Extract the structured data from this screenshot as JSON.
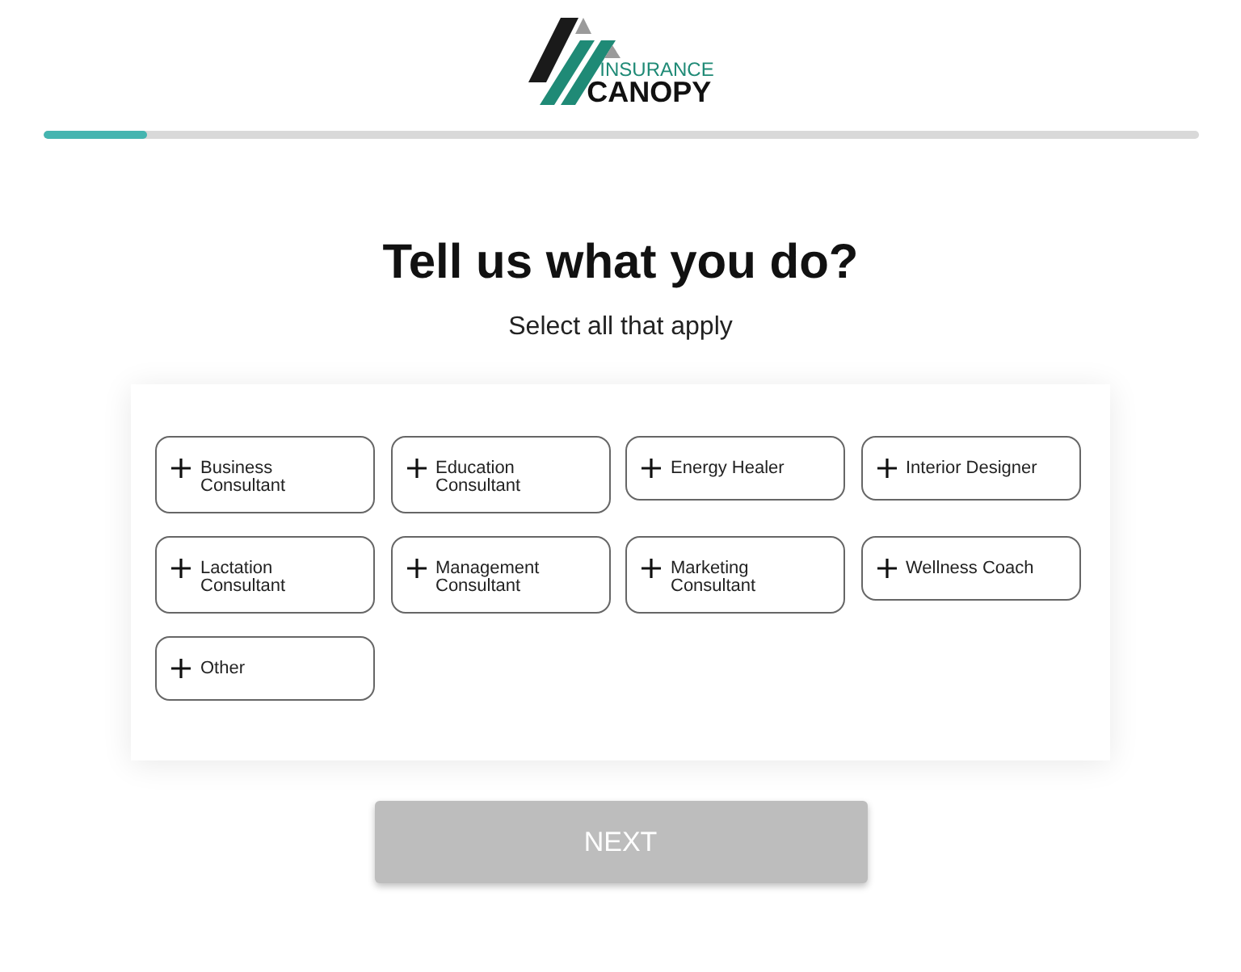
{
  "logo": {
    "text_top": "INSURANCE",
    "text_bottom": "CANOPY"
  },
  "progress": {
    "level": 0.09
  },
  "heading": "Tell us what you do?",
  "subheading": "Select all that apply",
  "options": [
    {
      "label": "Business Consultant",
      "selected": false
    },
    {
      "label": "Education Consultant",
      "selected": false
    },
    {
      "label": "Energy Healer",
      "selected": false
    },
    {
      "label": "Interior Designer",
      "selected": false
    },
    {
      "label": "Lactation Consultant",
      "selected": false
    },
    {
      "label": "Management Consultant",
      "selected": false
    },
    {
      "label": "Marketing Consultant",
      "selected": false
    },
    {
      "label": "Wellness Coach",
      "selected": false
    },
    {
      "label": "Other",
      "selected": false
    }
  ],
  "next_button": {
    "label": "NEXT",
    "disabled": true
  }
}
